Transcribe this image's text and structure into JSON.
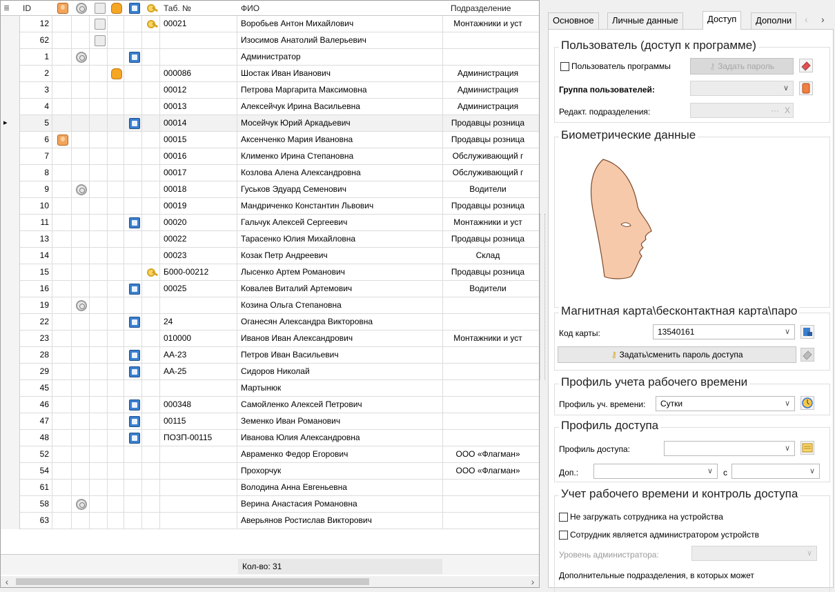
{
  "grid": {
    "header": {
      "id": "ID",
      "tab_no": "Таб. №",
      "fio": "ФИО",
      "dept": "Подразделение"
    },
    "rows": [
      {
        "id": "12",
        "tab": "00021",
        "fio": "Воробьев Антон Михайлович",
        "dept": "Монтажники и уст",
        "icons": {
          "palm": true,
          "key": true
        }
      },
      {
        "id": "62",
        "tab": "",
        "fio": "Изосимов Анатолий Валерьевич",
        "dept": "",
        "icons": {
          "palm": true
        }
      },
      {
        "id": "1",
        "tab": "",
        "fio": "Администратор",
        "dept": "",
        "icons": {
          "finger": true,
          "card": true
        }
      },
      {
        "id": "2",
        "tab": "000086",
        "fio": "Шостак Иван Иванович",
        "dept": "Администрация",
        "icons": {
          "hand": true
        }
      },
      {
        "id": "3",
        "tab": "00012",
        "fio": "Петрова Маргарита Максимовна",
        "dept": "Администрация",
        "icons": {}
      },
      {
        "id": "4",
        "tab": "00013",
        "fio": "Алексейчук Ирина Васильевна",
        "dept": "Администрация",
        "icons": {}
      },
      {
        "id": "5",
        "tab": "00014",
        "fio": "Мосейчук Юрий Аркадьевич",
        "dept": "Продавцы розница",
        "icons": {
          "card": true
        },
        "selected": true
      },
      {
        "id": "6",
        "tab": "00015",
        "fio": "Аксенченко Мария Ивановна",
        "dept": "Продавцы розница",
        "icons": {
          "face": true
        }
      },
      {
        "id": "7",
        "tab": "00016",
        "fio": "Клименко Ирина Степановна",
        "dept": "Обслуживающий г",
        "icons": {}
      },
      {
        "id": "8",
        "tab": "00017",
        "fio": "Козлова Алена Александровна",
        "dept": "Обслуживающий г",
        "icons": {}
      },
      {
        "id": "9",
        "tab": "00018",
        "fio": "Гуськов Эдуард Семенович",
        "dept": "Водители",
        "icons": {
          "finger": true
        }
      },
      {
        "id": "10",
        "tab": "00019",
        "fio": "Мандриченко Константин Львович",
        "dept": "Продавцы розница",
        "icons": {}
      },
      {
        "id": "11",
        "tab": "00020",
        "fio": "Гальчук Алексей Сергеевич",
        "dept": "Монтажники и уст",
        "icons": {
          "card": true
        }
      },
      {
        "id": "13",
        "tab": "00022",
        "fio": "Тарасенко Юлия Михайловна",
        "dept": "Продавцы розница",
        "icons": {}
      },
      {
        "id": "14",
        "tab": "00023",
        "fio": "Козак Петр Андреевич",
        "dept": "Склад",
        "icons": {}
      },
      {
        "id": "15",
        "tab": "Б000-00212",
        "fio": "Лысенко Артем Романович",
        "dept": "Продавцы розница",
        "icons": {
          "key": true
        }
      },
      {
        "id": "16",
        "tab": "00025",
        "fio": "Ковалев Виталий Артемович",
        "dept": "Водители",
        "icons": {
          "card": true
        }
      },
      {
        "id": "19",
        "tab": "",
        "fio": "Козина Ольга Степановна",
        "dept": "",
        "icons": {
          "finger": true
        }
      },
      {
        "id": "22",
        "tab": "24",
        "fio": "Оганесян Александра Викторовна",
        "dept": "",
        "icons": {
          "card": true
        }
      },
      {
        "id": "23",
        "tab": "010000",
        "fio": "Иванов Иван Александрович",
        "dept": "Монтажники и уст",
        "icons": {}
      },
      {
        "id": "28",
        "tab": "АА-23",
        "fio": "Петров Иван Васильевич",
        "dept": "",
        "icons": {
          "card": true
        }
      },
      {
        "id": "29",
        "tab": "АА-25",
        "fio": "Сидоров Николай",
        "dept": "",
        "icons": {
          "card": true
        }
      },
      {
        "id": "45",
        "tab": "",
        "fio": "Мартынюк",
        "dept": "",
        "icons": {}
      },
      {
        "id": "46",
        "tab": "000348",
        "fio": "Самойленко Алексей Петрович",
        "dept": "",
        "icons": {
          "card": true
        }
      },
      {
        "id": "47",
        "tab": "00115",
        "fio": "Земенко Иван Романович",
        "dept": "",
        "icons": {
          "card": true
        }
      },
      {
        "id": "48",
        "tab": "ПОЗП-00115",
        "fio": "Иванова Юлия Александровна",
        "dept": "",
        "icons": {
          "card": true
        }
      },
      {
        "id": "52",
        "tab": "",
        "fio": "Авраменко Федор Егорович",
        "dept": "ООО «Флагман»",
        "icons": {}
      },
      {
        "id": "54",
        "tab": "",
        "fio": "Прохорчук",
        "dept": "ООО «Флагман»",
        "icons": {}
      },
      {
        "id": "61",
        "tab": "",
        "fio": "Володина Анна Евгеньевна",
        "dept": "",
        "icons": {}
      },
      {
        "id": "58",
        "tab": "",
        "fio": "Верина Анастасия Романовна",
        "dept": "",
        "icons": {
          "finger": true
        }
      },
      {
        "id": "63",
        "tab": "",
        "fio": "Аверьянов Ростислав Викторович",
        "dept": "",
        "icons": {}
      }
    ],
    "footer_count": "Кол-во: 31"
  },
  "tabs": [
    "Основное",
    "Личные данные",
    "Доступ",
    "Дополни"
  ],
  "active_tab": "Доступ",
  "user_access": {
    "title": "Пользователь (доступ к программе)",
    "program_user_label": "Пользователь программы",
    "set_password_label": "Задать пароль",
    "user_group_label": "Группа пользователей:",
    "edit_departments_label": "Редакт. подразделения:"
  },
  "biometric": {
    "title": "Биометрические данные"
  },
  "card": {
    "title": "Магнитная карта\\бесконтактная карта\\паро",
    "code_label": "Код карты:",
    "code_value": "13540161",
    "set_access_password_label": "Задать\\сменить пароль доступа"
  },
  "worktime_profile": {
    "title": "Профиль учета рабочего времени",
    "label": "Профиль уч. времени:",
    "value": "Сутки"
  },
  "access_profile": {
    "title": "Профиль доступа",
    "label": "Профиль доступа:",
    "extra_label": "Доп.:",
    "from_label": "с"
  },
  "time_control": {
    "title": "Учет рабочего времени и контроль доступа",
    "no_upload_label": "Не загружать сотрудника на устройства",
    "is_admin_label": "Сотрудник является администратором устройств",
    "admin_level_label": "Уровень администратора:",
    "extra_depts_label": "Дополнительные подразделения, в которых может"
  },
  "colors": {
    "face_fill": "#f7c9ab",
    "face_stroke": "#7a4a2a",
    "card_icon": "#3a7fd0",
    "key_icon": "#d8a41e",
    "hand_icon": "#f5a623"
  }
}
